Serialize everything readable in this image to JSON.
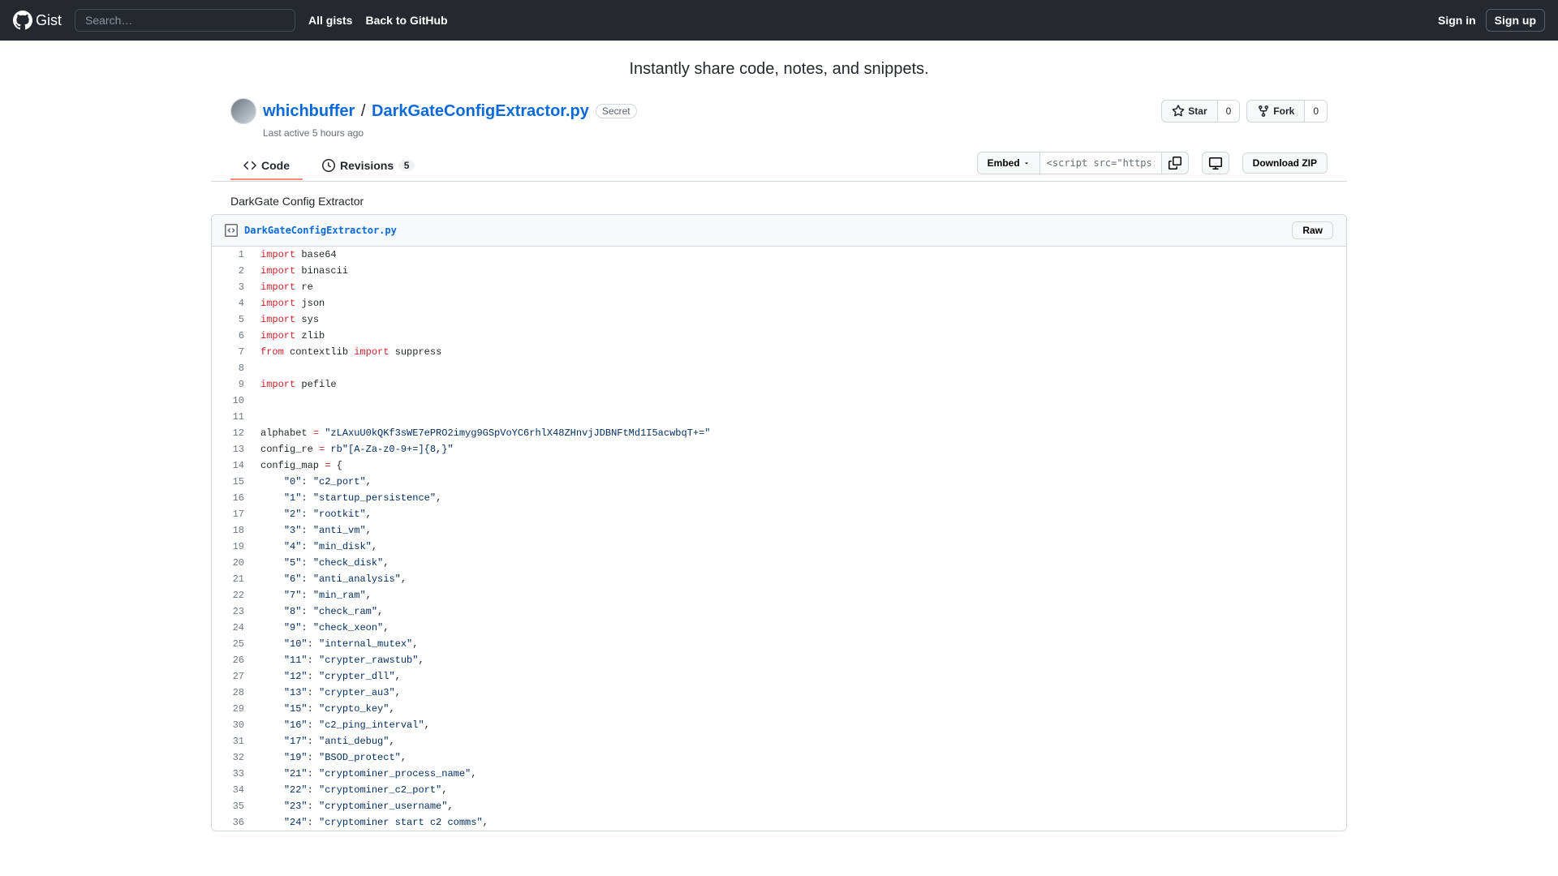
{
  "header": {
    "logo_text": "GitHub Gist",
    "search_placeholder": "Search…",
    "nav": {
      "all_gists": "All gists",
      "back": "Back to GitHub"
    },
    "signin": "Sign in",
    "signup": "Sign up"
  },
  "tagline": "Instantly share code, notes, and snippets.",
  "gist": {
    "author": "whichbuffer",
    "path_sep": "/",
    "name": "DarkGateConfigExtractor.py",
    "secret_label": "Secret",
    "meta": "Last active 5 hours ago",
    "description": "DarkGate Config Extractor"
  },
  "actions": {
    "star_label": "Star",
    "star_count": "0",
    "fork_label": "Fork",
    "fork_count": "0"
  },
  "tabs": {
    "code": "Code",
    "revisions": "Revisions",
    "revisions_count": "5"
  },
  "toolbar": {
    "embed": "Embed",
    "embed_value": "<script src=\"https://g",
    "download": "Download ZIP"
  },
  "file": {
    "name": "DarkGateConfigExtractor.py",
    "raw": "Raw"
  },
  "code_lines": [
    [
      {
        "t": "import",
        "c": "pl-k"
      },
      {
        "t": " base64",
        "c": ""
      }
    ],
    [
      {
        "t": "import",
        "c": "pl-k"
      },
      {
        "t": " binascii",
        "c": ""
      }
    ],
    [
      {
        "t": "import",
        "c": "pl-k"
      },
      {
        "t": " re",
        "c": ""
      }
    ],
    [
      {
        "t": "import",
        "c": "pl-k"
      },
      {
        "t": " json",
        "c": ""
      }
    ],
    [
      {
        "t": "import",
        "c": "pl-k"
      },
      {
        "t": " sys",
        "c": ""
      }
    ],
    [
      {
        "t": "import",
        "c": "pl-k"
      },
      {
        "t": " zlib",
        "c": ""
      }
    ],
    [
      {
        "t": "from",
        "c": "pl-k"
      },
      {
        "t": " contextlib ",
        "c": ""
      },
      {
        "t": "import",
        "c": "pl-k"
      },
      {
        "t": " suppress",
        "c": ""
      }
    ],
    [],
    [
      {
        "t": "import",
        "c": "pl-k"
      },
      {
        "t": " pefile",
        "c": ""
      }
    ],
    [],
    [],
    [
      {
        "t": "alphabet ",
        "c": ""
      },
      {
        "t": "=",
        "c": "pl-k"
      },
      {
        "t": " ",
        "c": ""
      },
      {
        "t": "\"zLAxuU0kQKf3sWE7ePRO2imyg9GSpVoYC6rhlX48ZHnvjJDBNFtMd1I5acwbqT+=\"",
        "c": "pl-s"
      }
    ],
    [
      {
        "t": "config_re ",
        "c": ""
      },
      {
        "t": "=",
        "c": "pl-k"
      },
      {
        "t": " ",
        "c": ""
      },
      {
        "t": "rb\"[A-Za-z0-9+=]{8,}\"",
        "c": "pl-s"
      }
    ],
    [
      {
        "t": "config_map ",
        "c": ""
      },
      {
        "t": "=",
        "c": "pl-k"
      },
      {
        "t": " {",
        "c": ""
      }
    ],
    [
      {
        "t": "    ",
        "c": ""
      },
      {
        "t": "\"0\"",
        "c": "pl-s"
      },
      {
        "t": ": ",
        "c": ""
      },
      {
        "t": "\"c2_port\"",
        "c": "pl-s"
      },
      {
        "t": ",",
        "c": ""
      }
    ],
    [
      {
        "t": "    ",
        "c": ""
      },
      {
        "t": "\"1\"",
        "c": "pl-s"
      },
      {
        "t": ": ",
        "c": ""
      },
      {
        "t": "\"startup_persistence\"",
        "c": "pl-s"
      },
      {
        "t": ",",
        "c": ""
      }
    ],
    [
      {
        "t": "    ",
        "c": ""
      },
      {
        "t": "\"2\"",
        "c": "pl-s"
      },
      {
        "t": ": ",
        "c": ""
      },
      {
        "t": "\"rootkit\"",
        "c": "pl-s"
      },
      {
        "t": ",",
        "c": ""
      }
    ],
    [
      {
        "t": "    ",
        "c": ""
      },
      {
        "t": "\"3\"",
        "c": "pl-s"
      },
      {
        "t": ": ",
        "c": ""
      },
      {
        "t": "\"anti_vm\"",
        "c": "pl-s"
      },
      {
        "t": ",",
        "c": ""
      }
    ],
    [
      {
        "t": "    ",
        "c": ""
      },
      {
        "t": "\"4\"",
        "c": "pl-s"
      },
      {
        "t": ": ",
        "c": ""
      },
      {
        "t": "\"min_disk\"",
        "c": "pl-s"
      },
      {
        "t": ",",
        "c": ""
      }
    ],
    [
      {
        "t": "    ",
        "c": ""
      },
      {
        "t": "\"5\"",
        "c": "pl-s"
      },
      {
        "t": ": ",
        "c": ""
      },
      {
        "t": "\"check_disk\"",
        "c": "pl-s"
      },
      {
        "t": ",",
        "c": ""
      }
    ],
    [
      {
        "t": "    ",
        "c": ""
      },
      {
        "t": "\"6\"",
        "c": "pl-s"
      },
      {
        "t": ": ",
        "c": ""
      },
      {
        "t": "\"anti_analysis\"",
        "c": "pl-s"
      },
      {
        "t": ",",
        "c": ""
      }
    ],
    [
      {
        "t": "    ",
        "c": ""
      },
      {
        "t": "\"7\"",
        "c": "pl-s"
      },
      {
        "t": ": ",
        "c": ""
      },
      {
        "t": "\"min_ram\"",
        "c": "pl-s"
      },
      {
        "t": ",",
        "c": ""
      }
    ],
    [
      {
        "t": "    ",
        "c": ""
      },
      {
        "t": "\"8\"",
        "c": "pl-s"
      },
      {
        "t": ": ",
        "c": ""
      },
      {
        "t": "\"check_ram\"",
        "c": "pl-s"
      },
      {
        "t": ",",
        "c": ""
      }
    ],
    [
      {
        "t": "    ",
        "c": ""
      },
      {
        "t": "\"9\"",
        "c": "pl-s"
      },
      {
        "t": ": ",
        "c": ""
      },
      {
        "t": "\"check_xeon\"",
        "c": "pl-s"
      },
      {
        "t": ",",
        "c": ""
      }
    ],
    [
      {
        "t": "    ",
        "c": ""
      },
      {
        "t": "\"10\"",
        "c": "pl-s"
      },
      {
        "t": ": ",
        "c": ""
      },
      {
        "t": "\"internal_mutex\"",
        "c": "pl-s"
      },
      {
        "t": ",",
        "c": ""
      }
    ],
    [
      {
        "t": "    ",
        "c": ""
      },
      {
        "t": "\"11\"",
        "c": "pl-s"
      },
      {
        "t": ": ",
        "c": ""
      },
      {
        "t": "\"crypter_rawstub\"",
        "c": "pl-s"
      },
      {
        "t": ",",
        "c": ""
      }
    ],
    [
      {
        "t": "    ",
        "c": ""
      },
      {
        "t": "\"12\"",
        "c": "pl-s"
      },
      {
        "t": ": ",
        "c": ""
      },
      {
        "t": "\"crypter_dll\"",
        "c": "pl-s"
      },
      {
        "t": ",",
        "c": ""
      }
    ],
    [
      {
        "t": "    ",
        "c": ""
      },
      {
        "t": "\"13\"",
        "c": "pl-s"
      },
      {
        "t": ": ",
        "c": ""
      },
      {
        "t": "\"crypter_au3\"",
        "c": "pl-s"
      },
      {
        "t": ",",
        "c": ""
      }
    ],
    [
      {
        "t": "    ",
        "c": ""
      },
      {
        "t": "\"15\"",
        "c": "pl-s"
      },
      {
        "t": ": ",
        "c": ""
      },
      {
        "t": "\"crypto_key\"",
        "c": "pl-s"
      },
      {
        "t": ",",
        "c": ""
      }
    ],
    [
      {
        "t": "    ",
        "c": ""
      },
      {
        "t": "\"16\"",
        "c": "pl-s"
      },
      {
        "t": ": ",
        "c": ""
      },
      {
        "t": "\"c2_ping_interval\"",
        "c": "pl-s"
      },
      {
        "t": ",",
        "c": ""
      }
    ],
    [
      {
        "t": "    ",
        "c": ""
      },
      {
        "t": "\"17\"",
        "c": "pl-s"
      },
      {
        "t": ": ",
        "c": ""
      },
      {
        "t": "\"anti_debug\"",
        "c": "pl-s"
      },
      {
        "t": ",",
        "c": ""
      }
    ],
    [
      {
        "t": "    ",
        "c": ""
      },
      {
        "t": "\"19\"",
        "c": "pl-s"
      },
      {
        "t": ": ",
        "c": ""
      },
      {
        "t": "\"BSOD_protect\"",
        "c": "pl-s"
      },
      {
        "t": ",",
        "c": ""
      }
    ],
    [
      {
        "t": "    ",
        "c": ""
      },
      {
        "t": "\"21\"",
        "c": "pl-s"
      },
      {
        "t": ": ",
        "c": ""
      },
      {
        "t": "\"cryptominer_process_name\"",
        "c": "pl-s"
      },
      {
        "t": ",",
        "c": ""
      }
    ],
    [
      {
        "t": "    ",
        "c": ""
      },
      {
        "t": "\"22\"",
        "c": "pl-s"
      },
      {
        "t": ": ",
        "c": ""
      },
      {
        "t": "\"cryptominer_c2_port\"",
        "c": "pl-s"
      },
      {
        "t": ",",
        "c": ""
      }
    ],
    [
      {
        "t": "    ",
        "c": ""
      },
      {
        "t": "\"23\"",
        "c": "pl-s"
      },
      {
        "t": ": ",
        "c": ""
      },
      {
        "t": "\"cryptominer_username\"",
        "c": "pl-s"
      },
      {
        "t": ",",
        "c": ""
      }
    ],
    [
      {
        "t": "    ",
        "c": ""
      },
      {
        "t": "\"24\"",
        "c": "pl-s"
      },
      {
        "t": ": ",
        "c": ""
      },
      {
        "t": "\"cryptominer start c2 comms\"",
        "c": "pl-s"
      },
      {
        "t": ",",
        "c": ""
      }
    ]
  ]
}
